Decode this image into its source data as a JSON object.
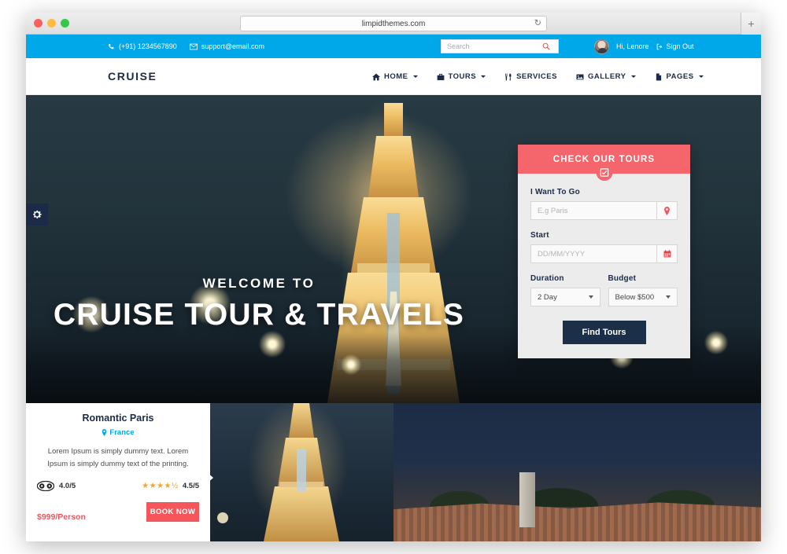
{
  "browser": {
    "url": "limpidthemes.com",
    "reload_icon": "reload-icon",
    "newtab_label": "+"
  },
  "topbar": {
    "phone": "(+91) 1234567890",
    "email": "support@email.com",
    "search": {
      "placeholder": "Search",
      "value": ""
    },
    "greeting": "Hi, Lenore",
    "signout": "Sign Out",
    "bg_color": "#00a7e9"
  },
  "navbar": {
    "logo": "CRUISE",
    "items": [
      {
        "label": "HOME",
        "icon": "home-icon",
        "has_caret": true
      },
      {
        "label": "TOURS",
        "icon": "briefcase-icon",
        "has_caret": true
      },
      {
        "label": "SERVICES",
        "icon": "utensils-icon",
        "has_caret": false
      },
      {
        "label": "GALLERY",
        "icon": "image-icon",
        "has_caret": true
      },
      {
        "label": "PAGES",
        "icon": "file-icon",
        "has_caret": true
      }
    ]
  },
  "hero": {
    "welcome": "WELCOME TO",
    "headline": "CRUISE TOUR & TRAVELS",
    "settings_tab_icon": "gear-icon"
  },
  "booking": {
    "title": "CHECK OUR TOURS",
    "badge_icon": "check-square-icon",
    "destination_label": "I Want To Go",
    "destination_placeholder": "E.g Paris",
    "destination_value": "",
    "destination_addon_icon": "map-pin-icon",
    "start_label": "Start",
    "start_placeholder": "DD/MM/YYYY",
    "start_value": "",
    "start_addon_icon": "calendar-icon",
    "duration_label": "Duration",
    "duration_value": "2 Day",
    "budget_label": "Budget",
    "budget_value": "Below $500",
    "submit_label": "Find Tours",
    "header_color": "#f4656c",
    "submit_color": "#1b3048"
  },
  "tour_card": {
    "title": "Romantic Paris",
    "country": "France",
    "country_icon": "map-pin-icon",
    "description": "Lorem Ipsum is simply dummy text. Lorem Ipsum is simply dummy text of the printing.",
    "tripadvisor_icon": "tripadvisor-icon",
    "tripadvisor_rating": "4.0/5",
    "stars": "★★★★½",
    "star_rating": "4.5/5",
    "price": "$999/Person",
    "book_label": "BOOK NOW",
    "accent_color": "#f4565c"
  }
}
